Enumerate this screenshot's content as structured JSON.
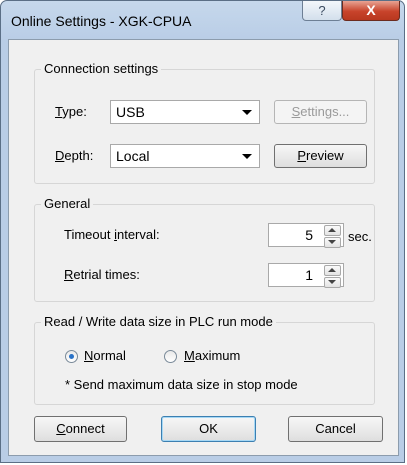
{
  "window": {
    "title": "Online Settings - XGK-CPUA",
    "help_glyph": "?",
    "close_glyph": "X"
  },
  "connection": {
    "legend": "Connection settings",
    "type_label_u": "T",
    "type_label_rest": "ype:",
    "type_value": "USB",
    "settings_u": "S",
    "settings_rest": "ettings...",
    "depth_label_u": "D",
    "depth_label_rest": "epth:",
    "depth_value": "Local",
    "preview_u": "P",
    "preview_rest": "review"
  },
  "general": {
    "legend": "General",
    "timeout_pre": "Timeout ",
    "timeout_u": "i",
    "timeout_post": "nterval:",
    "timeout_value": "5",
    "unit": "sec.",
    "retrial_u": "R",
    "retrial_rest": "etrial times:",
    "retrial_value": "1"
  },
  "rw": {
    "legend": "Read / Write data size in PLC run mode",
    "normal_u": "N",
    "normal_rest": "ormal",
    "maximum_u": "M",
    "maximum_rest": "aximum",
    "selected": "Normal",
    "note": "* Send maximum data size in stop mode"
  },
  "buttons": {
    "connect_u": "C",
    "connect_rest": "onnect",
    "ok": "OK",
    "cancel": "Cancel"
  }
}
